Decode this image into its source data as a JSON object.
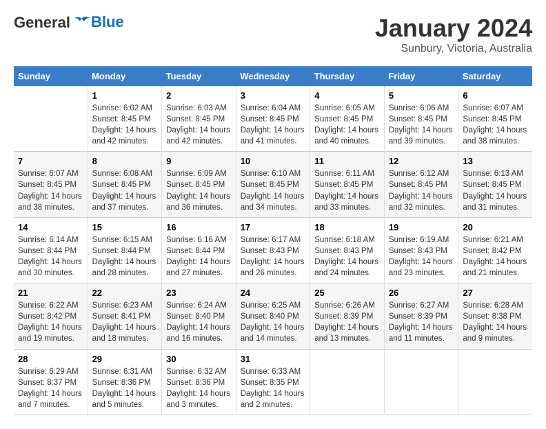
{
  "header": {
    "logo_line1": "General",
    "logo_line2": "Blue",
    "main_title": "January 2024",
    "subtitle": "Sunbury, Victoria, Australia"
  },
  "days_of_week": [
    "Sunday",
    "Monday",
    "Tuesday",
    "Wednesday",
    "Thursday",
    "Friday",
    "Saturday"
  ],
  "weeks": [
    [
      {
        "day": "",
        "lines": []
      },
      {
        "day": "1",
        "lines": [
          "Sunrise: 6:02 AM",
          "Sunset: 8:45 PM",
          "Daylight: 14 hours",
          "and 42 minutes."
        ]
      },
      {
        "day": "2",
        "lines": [
          "Sunrise: 6:03 AM",
          "Sunset: 8:45 PM",
          "Daylight: 14 hours",
          "and 42 minutes."
        ]
      },
      {
        "day": "3",
        "lines": [
          "Sunrise: 6:04 AM",
          "Sunset: 8:45 PM",
          "Daylight: 14 hours",
          "and 41 minutes."
        ]
      },
      {
        "day": "4",
        "lines": [
          "Sunrise: 6:05 AM",
          "Sunset: 8:45 PM",
          "Daylight: 14 hours",
          "and 40 minutes."
        ]
      },
      {
        "day": "5",
        "lines": [
          "Sunrise: 6:06 AM",
          "Sunset: 8:45 PM",
          "Daylight: 14 hours",
          "and 39 minutes."
        ]
      },
      {
        "day": "6",
        "lines": [
          "Sunrise: 6:07 AM",
          "Sunset: 8:45 PM",
          "Daylight: 14 hours",
          "and 38 minutes."
        ]
      }
    ],
    [
      {
        "day": "7",
        "lines": [
          "Sunrise: 6:07 AM",
          "Sunset: 8:45 PM",
          "Daylight: 14 hours",
          "and 38 minutes."
        ]
      },
      {
        "day": "8",
        "lines": [
          "Sunrise: 6:08 AM",
          "Sunset: 8:45 PM",
          "Daylight: 14 hours",
          "and 37 minutes."
        ]
      },
      {
        "day": "9",
        "lines": [
          "Sunrise: 6:09 AM",
          "Sunset: 8:45 PM",
          "Daylight: 14 hours",
          "and 36 minutes."
        ]
      },
      {
        "day": "10",
        "lines": [
          "Sunrise: 6:10 AM",
          "Sunset: 8:45 PM",
          "Daylight: 14 hours",
          "and 34 minutes."
        ]
      },
      {
        "day": "11",
        "lines": [
          "Sunrise: 6:11 AM",
          "Sunset: 8:45 PM",
          "Daylight: 14 hours",
          "and 33 minutes."
        ]
      },
      {
        "day": "12",
        "lines": [
          "Sunrise: 6:12 AM",
          "Sunset: 8:45 PM",
          "Daylight: 14 hours",
          "and 32 minutes."
        ]
      },
      {
        "day": "13",
        "lines": [
          "Sunrise: 6:13 AM",
          "Sunset: 8:45 PM",
          "Daylight: 14 hours",
          "and 31 minutes."
        ]
      }
    ],
    [
      {
        "day": "14",
        "lines": [
          "Sunrise: 6:14 AM",
          "Sunset: 8:44 PM",
          "Daylight: 14 hours",
          "and 30 minutes."
        ]
      },
      {
        "day": "15",
        "lines": [
          "Sunrise: 6:15 AM",
          "Sunset: 8:44 PM",
          "Daylight: 14 hours",
          "and 28 minutes."
        ]
      },
      {
        "day": "16",
        "lines": [
          "Sunrise: 6:16 AM",
          "Sunset: 8:44 PM",
          "Daylight: 14 hours",
          "and 27 minutes."
        ]
      },
      {
        "day": "17",
        "lines": [
          "Sunrise: 6:17 AM",
          "Sunset: 8:43 PM",
          "Daylight: 14 hours",
          "and 26 minutes."
        ]
      },
      {
        "day": "18",
        "lines": [
          "Sunrise: 6:18 AM",
          "Sunset: 8:43 PM",
          "Daylight: 14 hours",
          "and 24 minutes."
        ]
      },
      {
        "day": "19",
        "lines": [
          "Sunrise: 6:19 AM",
          "Sunset: 8:43 PM",
          "Daylight: 14 hours",
          "and 23 minutes."
        ]
      },
      {
        "day": "20",
        "lines": [
          "Sunrise: 6:21 AM",
          "Sunset: 8:42 PM",
          "Daylight: 14 hours",
          "and 21 minutes."
        ]
      }
    ],
    [
      {
        "day": "21",
        "lines": [
          "Sunrise: 6:22 AM",
          "Sunset: 8:42 PM",
          "Daylight: 14 hours",
          "and 19 minutes."
        ]
      },
      {
        "day": "22",
        "lines": [
          "Sunrise: 6:23 AM",
          "Sunset: 8:41 PM",
          "Daylight: 14 hours",
          "and 18 minutes."
        ]
      },
      {
        "day": "23",
        "lines": [
          "Sunrise: 6:24 AM",
          "Sunset: 8:40 PM",
          "Daylight: 14 hours",
          "and 16 minutes."
        ]
      },
      {
        "day": "24",
        "lines": [
          "Sunrise: 6:25 AM",
          "Sunset: 8:40 PM",
          "Daylight: 14 hours",
          "and 14 minutes."
        ]
      },
      {
        "day": "25",
        "lines": [
          "Sunrise: 6:26 AM",
          "Sunset: 8:39 PM",
          "Daylight: 14 hours",
          "and 13 minutes."
        ]
      },
      {
        "day": "26",
        "lines": [
          "Sunrise: 6:27 AM",
          "Sunset: 8:39 PM",
          "Daylight: 14 hours",
          "and 11 minutes."
        ]
      },
      {
        "day": "27",
        "lines": [
          "Sunrise: 6:28 AM",
          "Sunset: 8:38 PM",
          "Daylight: 14 hours",
          "and 9 minutes."
        ]
      }
    ],
    [
      {
        "day": "28",
        "lines": [
          "Sunrise: 6:29 AM",
          "Sunset: 8:37 PM",
          "Daylight: 14 hours",
          "and 7 minutes."
        ]
      },
      {
        "day": "29",
        "lines": [
          "Sunrise: 6:31 AM",
          "Sunset: 8:36 PM",
          "Daylight: 14 hours",
          "and 5 minutes."
        ]
      },
      {
        "day": "30",
        "lines": [
          "Sunrise: 6:32 AM",
          "Sunset: 8:36 PM",
          "Daylight: 14 hours",
          "and 3 minutes."
        ]
      },
      {
        "day": "31",
        "lines": [
          "Sunrise: 6:33 AM",
          "Sunset: 8:35 PM",
          "Daylight: 14 hours",
          "and 2 minutes."
        ]
      },
      {
        "day": "",
        "lines": []
      },
      {
        "day": "",
        "lines": []
      },
      {
        "day": "",
        "lines": []
      }
    ]
  ]
}
